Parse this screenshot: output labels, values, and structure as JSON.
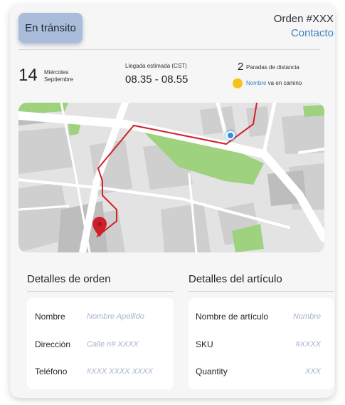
{
  "header": {
    "status_label": "En tránsito",
    "order_label": "Orden #XXX",
    "contact_label": "Contacto"
  },
  "delivery": {
    "day_number": "14",
    "weekday": "Miércoles",
    "month": "Septiembre",
    "eta_label": "Llegada estimada (CST)",
    "eta_range": "08.35 - 08.55",
    "stops_count": "2",
    "stops_label": "Paradas de distancia",
    "driver_name": "Nombre",
    "driver_status": " va en camino"
  },
  "map": {
    "route_color": "#d11f2a",
    "vehicle_color": "#2f8fe0",
    "destination_color": "#d11f2a",
    "park_color": "#9ed27e"
  },
  "order_details": {
    "title": "Detalles de orden",
    "rows": [
      {
        "label": "Nombre",
        "value": "Nombre Apellido"
      },
      {
        "label": "Dirección",
        "value": "Calle n# XXXX"
      },
      {
        "label": "Teléfono",
        "value": "#XXX XXXX XXXX"
      }
    ]
  },
  "item_details": {
    "title": "Detalles del artículo",
    "rows": [
      {
        "label": "Nombre de artículo",
        "value": "Nombre"
      },
      {
        "label": "SKU",
        "value": "#XXXX"
      },
      {
        "label": "Quantity",
        "value": "XXX"
      }
    ]
  },
  "colors": {
    "accent": "#3a85c5",
    "status_button": "#a9bcd9",
    "placeholder": "#a7b3cc",
    "driver_dot": "#f4c518"
  }
}
